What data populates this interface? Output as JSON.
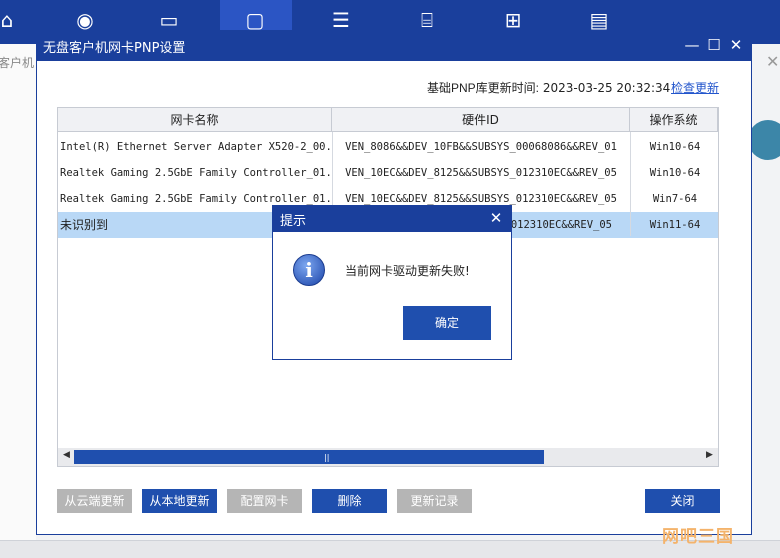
{
  "background": {
    "left_label": "客户机",
    "toolbar_icons": [
      "router-icon",
      "gamepad-icon",
      "monitor-icon",
      "list-icon",
      "toolbox-icon",
      "panel-icon",
      "card-icon"
    ]
  },
  "window": {
    "title": "无盘客户机网卡PNP设置",
    "update_label": "基础PNP库更新时间:",
    "update_time": "2023-03-25 20:32:34",
    "check_update": "检查更新"
  },
  "table": {
    "columns": [
      "网卡名称",
      "硬件ID",
      "操作系统"
    ],
    "rows": [
      {
        "name": "Intel(R) Ethernet Server Adapter X520-2_00...",
        "hwid": "VEN_8086&&DEV_10FB&&SUBSYS_00068086&&REV_01",
        "os": "Win10-64"
      },
      {
        "name": "Realtek Gaming 2.5GbE Family Controller_01...",
        "hwid": "VEN_10EC&&DEV_8125&&SUBSYS_012310EC&&REV_05",
        "os": "Win10-64"
      },
      {
        "name": "Realtek Gaming 2.5GbE Family Controller_01...",
        "hwid": "VEN_10EC&&DEV_8125&&SUBSYS_012310EC&&REV_05",
        "os": "Win7-64"
      },
      {
        "name": "未识别到",
        "hwid": "012310EC&&REV_05",
        "os": "Win11-64"
      }
    ]
  },
  "buttons": {
    "cloud": "从云端更新",
    "local": "从本地更新",
    "config": "配置网卡",
    "delete": "删除",
    "history": "更新记录",
    "close": "关闭"
  },
  "dialog": {
    "title": "提示",
    "message": "当前网卡驱动更新失败!",
    "ok": "确定"
  },
  "watermark": "网吧三国",
  "colors": {
    "accent": "#1a3f9c",
    "button_blue": "#1f4fae",
    "button_gray": "#b5b5b5",
    "selected_row": "#b9d8f6"
  }
}
